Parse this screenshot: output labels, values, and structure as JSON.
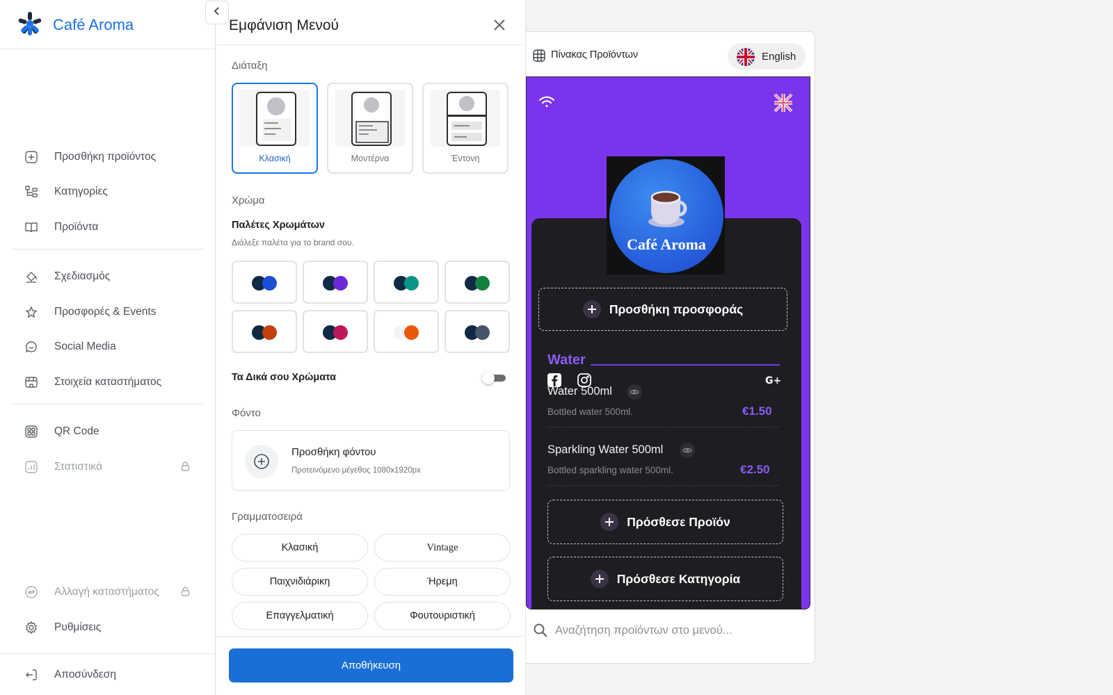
{
  "sidebar": {
    "brand": "Café Aroma",
    "items": [
      {
        "label": "Προσθήκη προϊόντος",
        "icon": "plus-square-icon"
      },
      {
        "label": "Κατηγορίες",
        "icon": "hierarchy-icon"
      },
      {
        "label": "Προϊόντα",
        "icon": "book-icon"
      },
      {
        "label": "Σχεδιασμός",
        "icon": "paint-bucket-icon"
      },
      {
        "label": "Προσφορές & Events",
        "icon": "sparkle-star-icon"
      },
      {
        "label": "Social Media",
        "icon": "chat-bubble-icon"
      },
      {
        "label": "Στοιχεία καταστήματος",
        "icon": "store-icon"
      },
      {
        "label": "QR Code",
        "icon": "qr-code-icon"
      },
      {
        "label": "Στατιστικά",
        "icon": "chart-icon",
        "locked": true
      },
      {
        "label": "Αλλαγή καταστήματος",
        "icon": "switch-icon",
        "locked": true
      },
      {
        "label": "Ρυθμίσεις",
        "icon": "gear-icon"
      },
      {
        "label": "Αποσύνδεση",
        "icon": "logout-icon"
      }
    ]
  },
  "panel": {
    "title": "Εμφάνιση Μενού",
    "layout_label": "Διάταξη",
    "layouts": [
      {
        "label": "Κλασική",
        "selected": true
      },
      {
        "label": "Μοντέρνα",
        "selected": false
      },
      {
        "label": "Έντονη",
        "selected": false
      }
    ],
    "color_label": "Χρώμα",
    "palettes_title": "Παλέτες Χρωμάτων",
    "palettes_desc": "Διάλεξε παλέτα για το brand σου.",
    "palettes": [
      {
        "c1": "#0f2a44",
        "c2": "#1d4ed8"
      },
      {
        "c1": "#0f2a44",
        "c2": "#6d28d9"
      },
      {
        "c1": "#0f2a44",
        "c2": "#0d9488"
      },
      {
        "c1": "#0f2a44",
        "c2": "#15803d"
      },
      {
        "c1": "#0f2a44",
        "c2": "#c2410c"
      },
      {
        "c1": "#0f2a44",
        "c2": "#be185d"
      },
      {
        "c1": "#f3f4f6",
        "c2": "#ea580c"
      },
      {
        "c1": "#0f2a44",
        "c2": "#475569"
      }
    ],
    "custom_colors_label": "Τα Δικά σου Χρώματα",
    "custom_colors_enabled": false,
    "background_label": "Φόντο",
    "background_add_title": "Προσθήκη φόντου",
    "background_add_desc": "Προτεινόμενο μέγεθος 1080x1920px",
    "font_label": "Γραμματοσειρά",
    "fonts": [
      "Κλασική",
      "Vintage",
      "Παιχνιδιάρικη",
      "Ήρεμη",
      "Επαγγελματική",
      "Φουτουριστική"
    ],
    "save_label": "Αποθήκευση"
  },
  "preview": {
    "top_label": "Πίνακας Προϊόντων",
    "language": "English",
    "accent": "#7a35ec",
    "logo_text": "Café Aroma",
    "add_offer": "Προσθήκη προσφοράς",
    "category": "Water",
    "items": [
      {
        "name": "Water 500ml",
        "desc": "Bottled water 500ml.",
        "price": "€1.50"
      },
      {
        "name": "Sparkling Water 500ml",
        "desc": "Bottled sparkling water 500ml.",
        "price": "€2.50"
      }
    ],
    "add_product": "Πρόσθεσε Προϊόν",
    "add_category": "Πρόσθεσε Κατηγορία",
    "search_placeholder": "Αναζήτηση προϊόντων στο μενού..."
  }
}
